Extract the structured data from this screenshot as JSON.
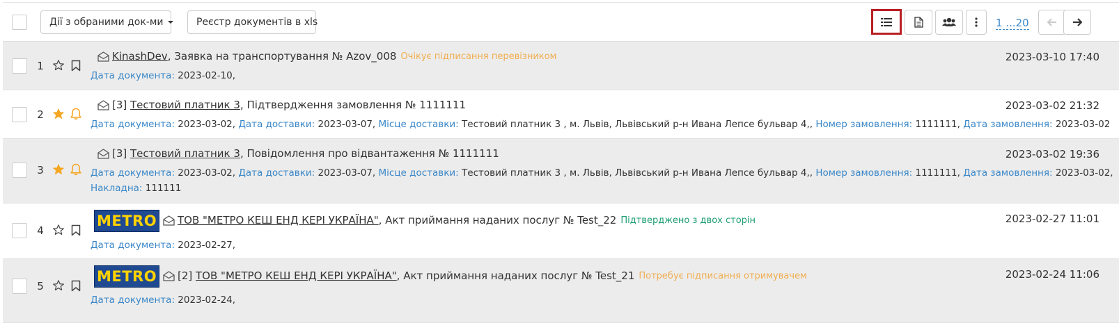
{
  "toolbar": {
    "actions_label": "Дії з обраними док-ми",
    "export_label": "Реєстр документів в xls",
    "pager": "1 ...20",
    "view_buttons": [
      "list-view-icon",
      "document-view-icon",
      "users-icon",
      "more-vert-icon"
    ],
    "active_view": "list-view-icon",
    "accent_color": "#b81f24"
  },
  "rows": [
    {
      "num": "1",
      "starred": false,
      "bell": false,
      "logo": "",
      "prefix": "",
      "party": "KinashDev",
      "doc": ", Заявка на транспортування № Azov_008",
      "status": "Очікує підписання перевізником",
      "date": "2023-03-10 17:40",
      "meta_line1": [
        {
          "k": "Дата документа:",
          "v": " 2023-02-10,"
        }
      ],
      "meta_line2": []
    },
    {
      "num": "2",
      "starred": true,
      "bell": true,
      "logo": "",
      "prefix": "[3] ",
      "party": "Тестовий платник 3",
      "doc": ", Підтвердження замовлення № 1111111",
      "status": "",
      "date": "2023-03-02 21:32",
      "meta_line1": [
        {
          "k": "Дата документа:",
          "v": " 2023-03-02, "
        },
        {
          "k": "Дата доставки:",
          "v": " 2023-03-07, "
        },
        {
          "k": "Місце доставки:",
          "v": " Тестовий платник 3 , м. Львів, Львівський р-н Ивана Лепсе бульвар 4,, "
        },
        {
          "k": "Номер замовлення:",
          "v": " 1111111, "
        },
        {
          "k": "Дата замовлення:",
          "v": " 2023-03-02"
        }
      ],
      "meta_line2": []
    },
    {
      "num": "3",
      "starred": true,
      "bell": true,
      "logo": "",
      "prefix": "[3] ",
      "party": "Тестовий платник 3",
      "doc": ", Повідомлення про відвантаження № 1111111",
      "status": "",
      "date": "2023-03-02 19:36",
      "meta_line1": [
        {
          "k": "Дата документа:",
          "v": " 2023-03-02, "
        },
        {
          "k": "Дата доставки:",
          "v": " 2023-03-07, "
        },
        {
          "k": "Місце доставки:",
          "v": " Тестовий платник 3 , м. Львів, Львівський р-н Ивана Лепсе бульвар 4,, "
        },
        {
          "k": "Номер замовлення:",
          "v": " 1111111, "
        },
        {
          "k": "Дата замовлення:",
          "v": " 2023-03-02,"
        }
      ],
      "meta_line2": [
        {
          "k": "Накладна:",
          "v": " 111111"
        }
      ]
    },
    {
      "num": "4",
      "starred": false,
      "bell": false,
      "logo": "METRO",
      "prefix": "",
      "party": "ТОВ \"МЕТРО КЕШ ЕНД КЕРІ УКРАЇНА\"",
      "doc": ", Акт приймання наданих послуг № Test_22",
      "status": "Підтверджено з двох сторін",
      "date": "2023-02-27 11:01",
      "meta_line1": [
        {
          "k": "Дата документа:",
          "v": " 2023-02-27,"
        }
      ],
      "meta_line2": []
    },
    {
      "num": "5",
      "starred": false,
      "bell": false,
      "logo": "METRO",
      "prefix": "[2] ",
      "party": "ТОВ \"МЕТРО КЕШ ЕНД КЕРІ УКРАЇНА\"",
      "doc": ", Акт приймання наданих послуг № Test_21",
      "status": "Потребує підписання отримувачем",
      "date": "2023-02-24 11:06",
      "meta_line1": [
        {
          "k": "Дата документа:",
          "v": " 2023-02-24,"
        }
      ],
      "meta_line2": []
    }
  ],
  "colors": {
    "link_key": "#3a87c8",
    "status_orange": "#f0ad4e",
    "status_green": "#1d9e74",
    "star": "#f5a623",
    "metro_bg": "#1f4a91",
    "metro_text": "#ffd200"
  }
}
